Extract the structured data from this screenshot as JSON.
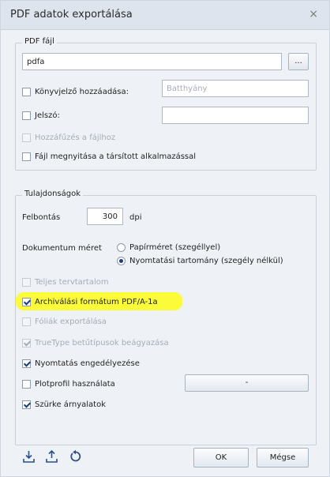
{
  "dialog": {
    "title": "PDF adatok exportálása",
    "close_glyph": "×"
  },
  "file_group": {
    "legend": "PDF fájl",
    "filename_value": "pdfa",
    "browse_label": "...",
    "bookmarks_label": "Könyvjelző hozzáadása:",
    "bookmarks_value": "Batthyány",
    "password_label": "Jelszó:",
    "password_value": "",
    "append_label": "Hozzáfűzés a fájlhoz",
    "open_label": "Fájl megnyitása a társított alkalmazással"
  },
  "props_group": {
    "legend": "Tulajdonságok",
    "resolution_label": "Felbontás",
    "resolution_value": "300",
    "resolution_unit": "dpi",
    "docsize_label": "Dokumentum méret",
    "paper_label": "Papírméret (szegéllyel)",
    "print_range_label": "Nyomtatási tartomány (szegély nélkül)",
    "full_content_label": "Teljes tervtartalom",
    "archive_label": "Archiválási formátum PDF/A-1a",
    "layers_label": "Fóliák exportálása",
    "truetype_label": "TrueType betűtípusok beágyazása",
    "allow_print_label": "Nyomtatás engedélyezése",
    "plot_profile_label": "Plotprofil használata",
    "plot_profile_button": "-",
    "grayscale_label": "Szürke árnyalatok"
  },
  "footer": {
    "ok_label": "OK",
    "cancel_label": "Mégse"
  },
  "colors": {
    "highlight": "#fbfb3a",
    "check": "#1e3c78",
    "title_bar": "#dde4ed"
  },
  "icons": [
    "import-icon",
    "export-icon",
    "reset-icon"
  ]
}
